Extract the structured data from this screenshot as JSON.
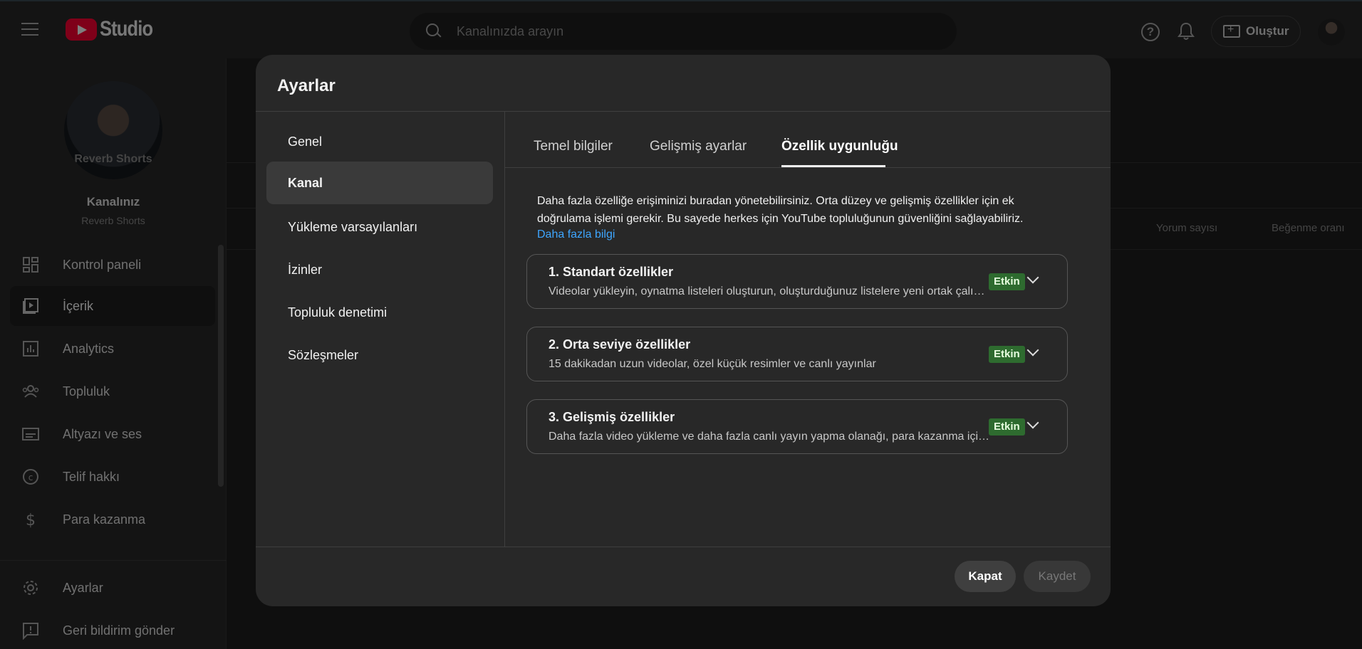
{
  "app": {
    "logo_text": "Studio"
  },
  "search": {
    "placeholder": "Kanalınızda arayın"
  },
  "header": {
    "create_label": "Oluştur"
  },
  "channel": {
    "brand_overlay": "Reverb Shorts",
    "title": "Kanalınız",
    "handle": "Reverb Shorts"
  },
  "sidebar": {
    "items": [
      {
        "label": "Kontrol paneli",
        "icon": "dashboard-icon"
      },
      {
        "label": "İçerik",
        "icon": "content-icon",
        "active": true
      },
      {
        "label": "Analytics",
        "icon": "analytics-icon"
      },
      {
        "label": "Topluluk",
        "icon": "community-icon"
      },
      {
        "label": "Altyazı ve ses",
        "icon": "subtitles-icon"
      },
      {
        "label": "Telif hakkı",
        "icon": "copyright-icon"
      },
      {
        "label": "Para kazanma",
        "icon": "dollar-icon"
      }
    ],
    "bottom": [
      {
        "label": "Ayarlar",
        "icon": "gear-icon"
      },
      {
        "label": "Geri bildirim gönder",
        "icon": "feedback-icon"
      }
    ]
  },
  "background": {
    "columns": [
      "Yorum sayısı",
      "Beğenme oranı"
    ]
  },
  "dialog": {
    "title": "Ayarlar",
    "menu": [
      "Genel",
      "Kanal",
      "Yükleme varsayılanları",
      "İzinler",
      "Topluluk denetimi",
      "Sözleşmeler"
    ],
    "tabs": [
      "Temel bilgiler",
      "Gelişmiş ayarlar",
      "Özellik uygunluğu"
    ],
    "description": "Daha fazla özelliğe erişiminizi buradan yönetebilirsiniz. Orta düzey ve gelişmiş özellikler için ek doğrulama işlemi gerekir. Bu sayede herkes için YouTube topluluğunun güvenliğini sağlayabiliriz.",
    "learn_more": "Daha fazla bilgi",
    "cards": [
      {
        "title": "1. Standart özellikler",
        "subtitle": "Videolar yükleyin, oynatma listeleri oluşturun, oluşturduğunuz listelere yeni ortak çalışanlar ekleyin",
        "status": "Etkin"
      },
      {
        "title": "2. Orta seviye özellikler",
        "subtitle": "15 dakikadan uzun videolar, özel küçük resimler ve canlı yayınlar",
        "status": "Etkin"
      },
      {
        "title": "3. Gelişmiş özellikler",
        "subtitle": "Daha fazla video yükleme ve daha fazla canlı yayın yapma olanağı, para kazanma için başvuru",
        "status": "Etkin"
      }
    ],
    "close_label": "Kapat",
    "save_label": "Kaydet"
  }
}
